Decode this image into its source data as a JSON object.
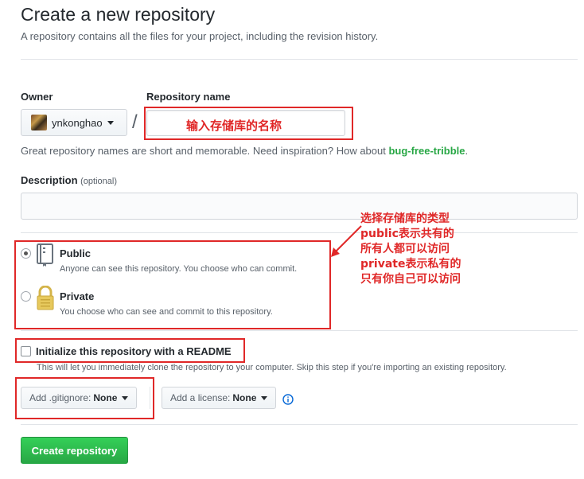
{
  "header": {
    "title": "Create a new repository",
    "subtitle": "A repository contains all the files for your project, including the revision history."
  },
  "owner": {
    "label": "Owner",
    "value": "ynkonghao"
  },
  "repo_name": {
    "label": "Repository name",
    "annotation": "输入存储库的名称",
    "slash": "/"
  },
  "hint": {
    "prefix": "Great repository names are short and memorable. Need inspiration? How about ",
    "suggestion": "bug-free-tribble",
    "suffix": "."
  },
  "description": {
    "label": "Description",
    "optional": "(optional)",
    "value": ""
  },
  "visibility": {
    "public_title": "Public",
    "public_note": "Anyone can see this repository. You choose who can commit.",
    "private_title": "Private",
    "private_note": "You choose who can see and commit to this repository.",
    "selected": "public"
  },
  "visibility_annotation": {
    "line1": "选择存储库的类型",
    "line2": "public表示共有的",
    "line3": "所有人都可以访问",
    "line4": "private表示私有的",
    "line5": "只有你自己可以访问"
  },
  "readme": {
    "label": "Initialize this repository with a README",
    "note": "This will let you immediately clone the repository to your computer. Skip this step if you're importing an existing repository.",
    "checked": false
  },
  "gitignore": {
    "label": "Add .gitignore:",
    "value": "None"
  },
  "license": {
    "label": "Add a license:",
    "value": "None"
  },
  "create_button": "Create repository",
  "colors": {
    "annotation": "#e02828",
    "primary_button": "#28a745",
    "suggestion": "#28a745",
    "info": "#0366d6"
  }
}
